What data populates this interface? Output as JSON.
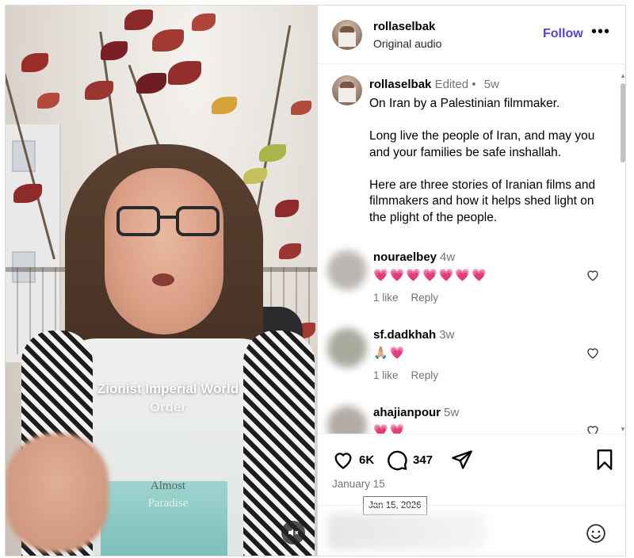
{
  "video": {
    "caption_line1": "Zionist Imperial World",
    "caption_line2": "Order",
    "shirt_line1": "Almost",
    "shirt_line2": "Paradise",
    "mute_icon": "speaker-muted-icon"
  },
  "header": {
    "username": "rollaselbak",
    "audio": "Original audio",
    "follow_label": "Follow",
    "more_label": "•••"
  },
  "post": {
    "username": "rollaselbak",
    "edited": "Edited",
    "separator": "•",
    "age": "5w",
    "paragraphs": [
      "On Iran by a Palestinian filmmaker.",
      "Long live the people of Iran, and may you and your families be safe inshallah.",
      "Here are three stories of Iranian films and filmmakers and how it helps shed light on the plight of the people."
    ]
  },
  "comments": [
    {
      "username": "nouraelbey",
      "age": "4w",
      "text": "💗💗💗💗💗💗💗",
      "likes": "1 like",
      "reply": "Reply"
    },
    {
      "username": "sf.dadkhah",
      "age": "3w",
      "text": "🙏🏼💗",
      "likes": "1 like",
      "reply": "Reply"
    },
    {
      "username": "ahajianpour",
      "age": "5w",
      "text": "💗💗",
      "likes": "",
      "reply": ""
    }
  ],
  "actions": {
    "like_count": "6K",
    "comment_count": "347",
    "date": "January 15",
    "tooltip": "Jan 15, 2026"
  },
  "colors": {
    "follow": "#5b3fd9",
    "muted_text": "#737373",
    "border": "#dbdbdb"
  }
}
